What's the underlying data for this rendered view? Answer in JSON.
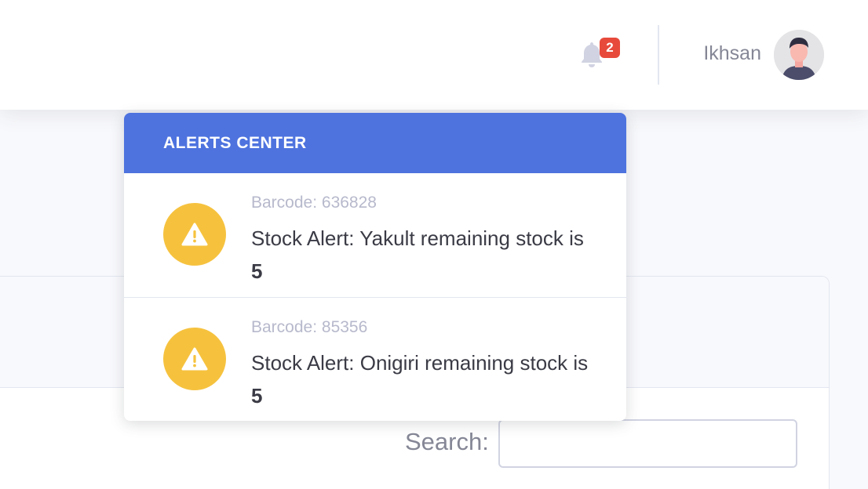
{
  "topbar": {
    "notification_count": "2",
    "user_name": "Ikhsan"
  },
  "alerts": {
    "title": "Alerts Center",
    "items": [
      {
        "barcode": "Barcode: 636828",
        "message": "Stock Alert: Yakult remaining stock is ",
        "stock": "5"
      },
      {
        "barcode": "Barcode: 85356",
        "message": "Stock Alert: Onigiri remaining stock is ",
        "stock": "5"
      }
    ]
  },
  "table": {
    "search_label": "Search:",
    "search_value": ""
  },
  "colors": {
    "primary": "#4e73df",
    "warning": "#f6c23e",
    "danger": "#e74a3b"
  },
  "icons": {
    "bell": "bell-icon",
    "alert": "exclamation-triangle-icon"
  }
}
